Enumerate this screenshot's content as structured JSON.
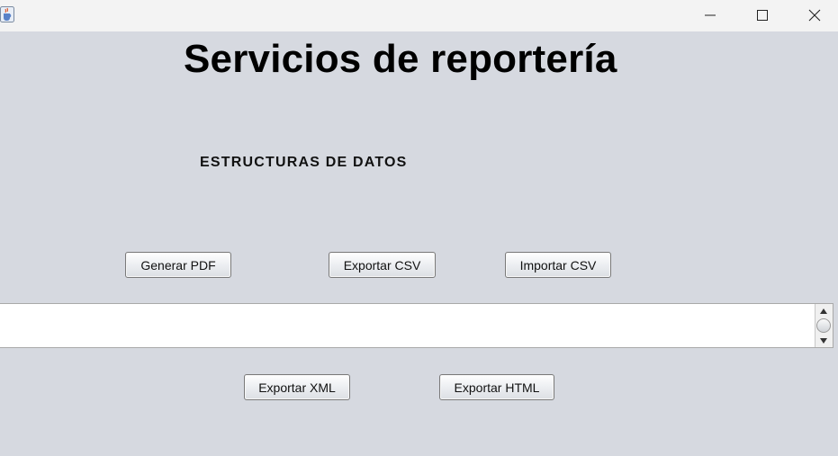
{
  "window": {
    "app_icon": "java-cup-icon",
    "controls": [
      "minimize-icon",
      "maximize-icon",
      "close-icon"
    ]
  },
  "header": {
    "title": "Servicios de reportería",
    "subtitle": "ESTRUCTURAS DE DATOS"
  },
  "buttons": {
    "generate_pdf": "Generar PDF",
    "export_csv": "Exportar CSV",
    "import_csv": "Importar CSV",
    "export_xml": "Exportar XML",
    "export_html": "Exportar HTML"
  },
  "output_area": {
    "value": ""
  },
  "colors": {
    "background": "#d6d9e0",
    "titlebar": "#f3f3f3"
  }
}
